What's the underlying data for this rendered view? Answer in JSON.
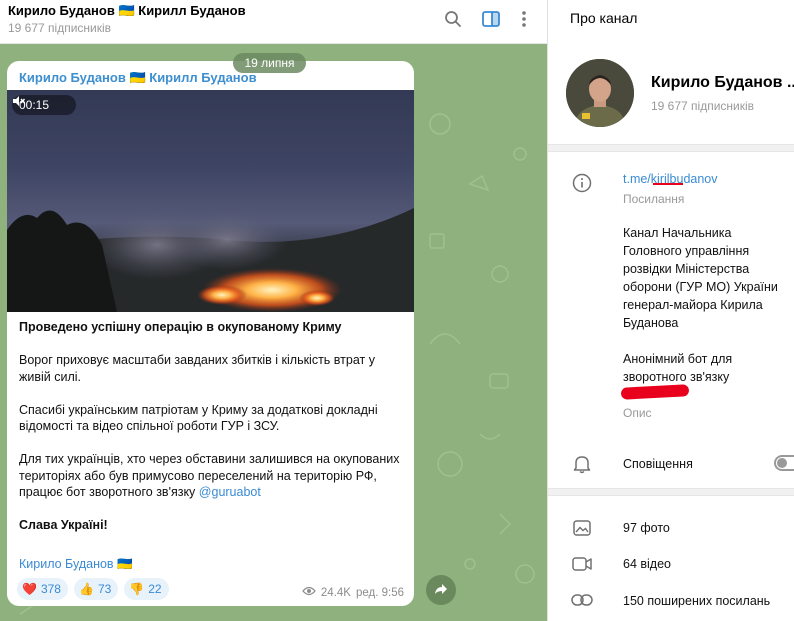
{
  "header": {
    "title": "Кирило Буданов 🇺🇦 Кирилл Буданов",
    "subscribers": "19 677 підписників"
  },
  "chat": {
    "date": "19 липня",
    "message": {
      "author": "Кирило Буданов 🇺🇦 Кирилл Буданов",
      "video_duration": "00:15",
      "headline": "Проведено успішну операцію в окупованому Криму",
      "para1": "Ворог приховує масштаби завданих збитків і кількість втрат у живій силі.",
      "para2": "Спасибі українським патріотам у Криму за додаткові докладні відомості та відео спільної роботи ГУР і ЗСУ.",
      "para3_text": "Для тих українців, хто через обставини залишився на окупованих територіях або був примусово переселений на територію РФ, працює бот зворотного зв'язку ",
      "para3_link": "@guruabot",
      "closing": "Слава Україні!",
      "signature": "Кирило Буданов 🇺🇦",
      "reactions": [
        {
          "emoji": "❤️",
          "count": "378"
        },
        {
          "emoji": "👍",
          "count": "73"
        },
        {
          "emoji": "👎",
          "count": "22"
        }
      ],
      "views": "24.4K",
      "edited_time": "ред. 9:56"
    }
  },
  "panel": {
    "title": "Про канал",
    "name": "Кирило Буданов ...",
    "subscribers": "19 677 підписників",
    "link_prefix": "t.me/",
    "link_user": "kirilbudanov",
    "link_caption": "Посилання",
    "description": "Канал Начальника Головного управління розвідки Міністерства оборони (ГУР МО) України генерал-майора Кирила Буданова",
    "description2": "Анонімний бот для зворотного зв'язку",
    "description_caption": "Опис",
    "notifications_label": "Сповіщення",
    "media_rows": [
      {
        "icon": "photo-icon",
        "label": "97 фото"
      },
      {
        "icon": "video-icon",
        "label": "64 відео"
      },
      {
        "icon": "link-icon",
        "label": "150 поширених посилань"
      }
    ]
  }
}
